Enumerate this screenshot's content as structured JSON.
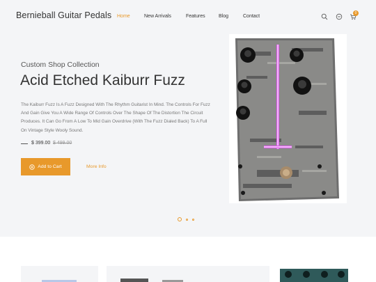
{
  "header": {
    "logo": "Bernieball Guitar Pedals",
    "nav": [
      "Home",
      "New Arrivals",
      "Features",
      "Blog",
      "Contact"
    ],
    "active_nav": "Home",
    "icons": [
      "search-icon",
      "user-icon",
      "cart-icon"
    ],
    "cart_count": "0"
  },
  "hero": {
    "subtitle": "Custom Shop Collection",
    "title": "Acid Etched Kaiburr Fuzz",
    "description": "The Kaiburr Fuzz Is A Fuzz Designed With The Rhythm Guitarist In Mind. The Controls For Fuzz And Gain Give You A Wide Range Of Controls Over The Shape Of The Distortion The Circuit Produces. It Can Go From A Low To Mid Gain Overdrive (With The Fuzz Dialed Back) To A Full On Vintage Style Wooly Sound.",
    "price": "$ 399.00",
    "old_price": "$ 499.00",
    "add_to_cart": "Add to Cart",
    "more_info": "More Info",
    "slider_dots": 3,
    "active_slide": 1
  },
  "colors": {
    "accent": "#e8992b",
    "hero_bg": "#f4f5f7",
    "text": "#333333"
  }
}
